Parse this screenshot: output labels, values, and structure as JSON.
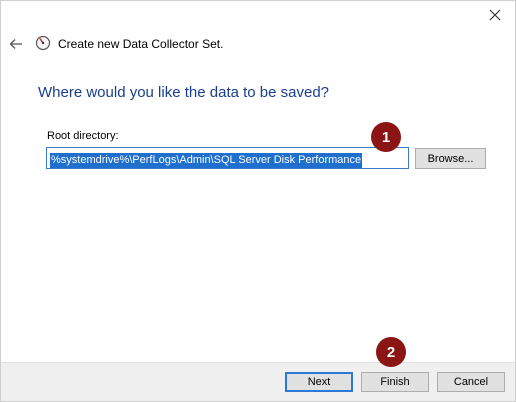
{
  "window": {
    "title": "Create new Data Collector Set."
  },
  "icons": {
    "close": "close-icon",
    "back": "back-arrow-icon",
    "app": "performance-monitor-icon"
  },
  "page": {
    "heading": "Where would you like the data to be saved?",
    "root_directory_label": "Root directory:",
    "root_directory_value": "%systemdrive%\\PerfLogs\\Admin\\SQL Server Disk Performance",
    "browse_label": "Browse..."
  },
  "annotations": {
    "callout_1": "1",
    "callout_2": "2",
    "callout_color": "#8b1414"
  },
  "footer": {
    "next_label": "Next",
    "finish_label": "Finish",
    "cancel_label": "Cancel"
  },
  "colors": {
    "heading": "#1a3d8f",
    "selection": "#1f6fce"
  }
}
